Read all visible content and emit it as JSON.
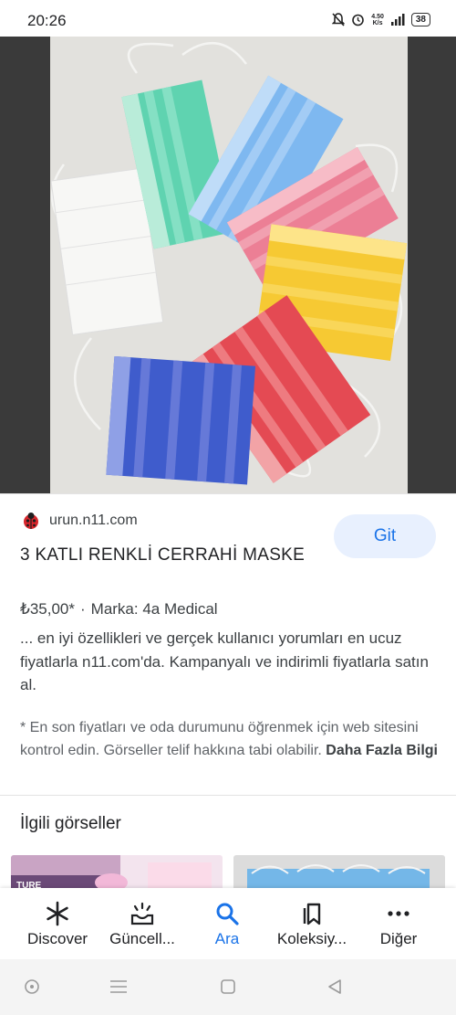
{
  "status_bar": {
    "time": "20:26",
    "network_speed": "4.50",
    "battery": "38"
  },
  "result": {
    "source": "urun.n11.com",
    "open_button": "Git",
    "title": "3 KATLI RENKLİ CERRAHİ MASKE",
    "price": "₺35,00*",
    "brand": "Marka: 4a Medical",
    "description": "... en iyi özellikleri ve gerçek kullanıcı yorumları en ucuz fiyatlarla n11.com'da. Kampanyalı ve indirimli fiyatlarla satın al.",
    "note": "* En son fiyatları ve oda durumunu öğrenmek için web sitesini kontrol edin. Görseller telif hakkına tabi olabilir.",
    "note_link": "Daha Fazla Bilgi"
  },
  "related": {
    "heading": "İlgili görseller",
    "thumb1_text": "TURE"
  },
  "bottom_nav": [
    {
      "label": "Discover",
      "icon": "asterisk-icon"
    },
    {
      "label": "Güncell...",
      "icon": "updates-icon"
    },
    {
      "label": "Ara",
      "icon": "search-icon",
      "active": true
    },
    {
      "label": "Koleksiy...",
      "icon": "collections-icon"
    },
    {
      "label": "Diğer",
      "icon": "more-icon"
    }
  ],
  "colors": {
    "accent": "#1a73e8",
    "git_bg": "#e8f0fe"
  }
}
